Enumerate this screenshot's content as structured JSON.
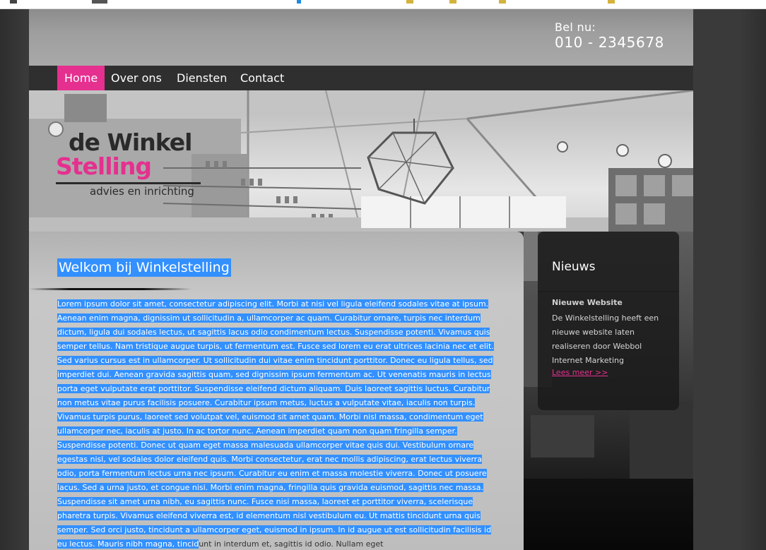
{
  "header": {
    "phone_label": "Bel nu:",
    "phone_number": "010 - 2345678"
  },
  "nav": {
    "items": [
      {
        "label": "Home",
        "active": true
      },
      {
        "label": "Over ons",
        "active": false
      },
      {
        "label": "Diensten",
        "active": false
      },
      {
        "label": "Contact",
        "active": false
      }
    ]
  },
  "logo": {
    "line1": "de Winkel",
    "line2": "Stelling",
    "tagline": "advies en inrichting"
  },
  "main": {
    "title": "Welkom bij Winkelstelling",
    "body_selected": "Lorem ipsum dolor sit amet, consectetur adipiscing elit. Morbi at nisi vel ligula eleifend sodales vitae at ipsum. Aenean enim magna, dignissim ut sollicitudin a, ullamcorper ac quam. Curabitur ornare, turpis nec interdum dictum, ligula dui sodales lectus, ut sagittis lacus odio condimentum lectus. Suspendisse potenti. Vivamus quis semper tellus. Nam tristique augue turpis, ut fermentum est. Fusce sed lorem eu erat ultrices lacinia nec et elit. Sed varius cursus est in ullamcorper. Ut sollicitudin dui vitae enim tincidunt porttitor. Donec eu ligula tellus, sed imperdiet dui. Aenean gravida sagittis quam, sed dignissim ipsum fermentum ac. Ut venenatis mauris in lectus porta eget vulputate erat porttitor. Suspendisse eleifend dictum aliquam. Duis laoreet sagittis luctus. Curabitur non metus vitae purus facilisis posuere. Curabitur ipsum metus, luctus a vulputate vitae, iaculis non turpis. Vivamus turpis purus, laoreet sed volutpat vel, euismod sit amet quam. Morbi nisl massa, condimentum eget ullamcorper nec, iaculis at justo. In ac tortor nunc. Aenean imperdiet quam non quam fringilla semper. Suspendisse potenti. Donec ut quam eget massa malesuada ullamcorper vitae quis dui. Vestibulum ornare egestas nisl, vel sodales dolor eleifend quis. Morbi consectetur, erat nec mollis adipiscing, erat lectus viverra odio, porta fermentum lectus urna nec ipsum. Curabitur eu enim et massa molestie viverra. Donec ut posuere lacus. Sed a urna justo, et congue nisi. Morbi enim magna, fringilla quis gravida euismod, sagittis nec massa. Suspendisse sit amet urna nibh, eu sagittis nunc. Fusce nisi massa, laoreet et porttitor viverra, scelerisque pharetra turpis. Vivamus eleifend viverra est, id elementum nisl vestibulum eu. Ut mattis tincidunt urna quis semper. Sed orci justo, tincidunt a ullamcorper eget, euismod in ipsum. In id augue ut est sollicitudin facilisis id eu lectus. Mauris nibh magna, tincid",
    "body_unselected": "unt in interdum et, sagittis id odio. Nullam eget"
  },
  "news": {
    "title": "Nieuws",
    "item_title": "Nieuwe Website",
    "item_body": "De Winkelstelling heeft een nieuwe website laten realiseren door Webbol Internet Marketing",
    "link": "Lees meer >>"
  },
  "colors": {
    "accent_pink": "#e5308f",
    "selection_blue": "#3390ff",
    "nav_bg": "#2f2f2f"
  }
}
